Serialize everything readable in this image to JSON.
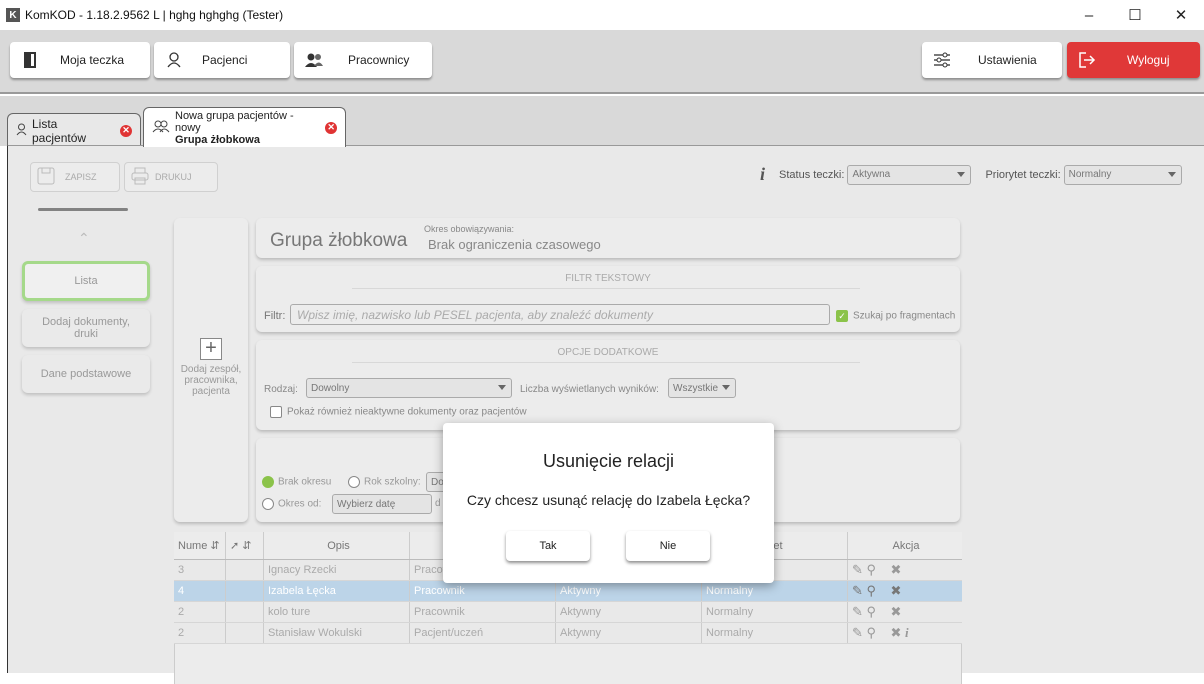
{
  "window": {
    "logo": "K",
    "title": "KomKOD - 1.18.2.9562 L | hghg hghghg (Tester)"
  },
  "topnav": {
    "moja_teczka": "Moja teczka",
    "pacjenci": "Pacjenci",
    "pracownicy": "Pracownicy",
    "ustawienia": "Ustawienia",
    "wyloguj": "Wyloguj"
  },
  "tabs": [
    {
      "label": "Lista pacjentów"
    },
    {
      "label_line1": "Nowa grupa pacjentów - nowy",
      "label_line2": "Grupa żłobkowa"
    }
  ],
  "toolbar": {
    "zapisz": "ZAPISZ",
    "drukuj": "DRUKUJ",
    "status_label": "Status teczki:",
    "status_value": "Aktywna",
    "priorytet_label": "Priorytet teczki:",
    "priorytet_value": "Normalny"
  },
  "leftnav": {
    "items": [
      "Lista",
      "Dodaj dokumenty, druki",
      "Dane podstawowe"
    ]
  },
  "add_panel": {
    "label": "Dodaj zespół, pracownika, pacjenta"
  },
  "header": {
    "title": "Grupa żłobkowa",
    "okres_label": "Okres obowiązywania:",
    "okres_value": "Brak ograniczenia czasowego"
  },
  "filter": {
    "section": "FILTR TEKSTOWY",
    "label": "Filtr:",
    "placeholder": "Wpisz imię, nazwisko lub PESEL pacjenta, aby znaleźć dokumenty",
    "fragment_label": "Szukaj po fragmentach"
  },
  "options": {
    "section": "OPCJE DODATKOWE",
    "rodzaj_label": "Rodzaj:",
    "rodzaj_value": "Dowolny",
    "liczba_label": "Liczba wyświetlanych wyników:",
    "liczba_value": "Wszystkie",
    "nieaktywne_label": "Pokaż również nieaktywne dokumenty oraz pacjentów"
  },
  "period": {
    "brak_okresu": "Brak okresu",
    "rok_szkolny": "Rok szkolny:",
    "rok_value": "Do",
    "okres_od": "Okres od:",
    "date_placeholder": "Wybierz datę",
    "to_label": "d"
  },
  "table": {
    "headers": [
      "Nume",
      "Opis",
      "",
      "",
      "tet",
      "Akcja"
    ],
    "rows": [
      {
        "nr": "3",
        "opis": "Ignacy Rzecki",
        "typ": "Pracow",
        "status": "",
        "priorytet": ""
      },
      {
        "nr": "4",
        "opis": "Izabela Łęcka",
        "typ": "Pracownik",
        "status": "Aktywny",
        "priorytet": "Normalny"
      },
      {
        "nr": "2",
        "opis": "kolo ture",
        "typ": "Pracownik",
        "status": "Aktywny",
        "priorytet": "Normalny"
      },
      {
        "nr": "2",
        "opis": "Stanisław Wokulski",
        "typ": "Pacjent/uczeń",
        "status": "Aktywny",
        "priorytet": "Normalny"
      }
    ]
  },
  "dialog": {
    "title": "Usunięcie relacji",
    "message": "Czy chcesz usunąć relację do Izabela Łęcka?",
    "yes": "Tak",
    "no": "Nie"
  },
  "colors": {
    "accent_green": "#8bc34a",
    "logout_red": "#e03838",
    "selected_row": "#bcd4e8"
  }
}
